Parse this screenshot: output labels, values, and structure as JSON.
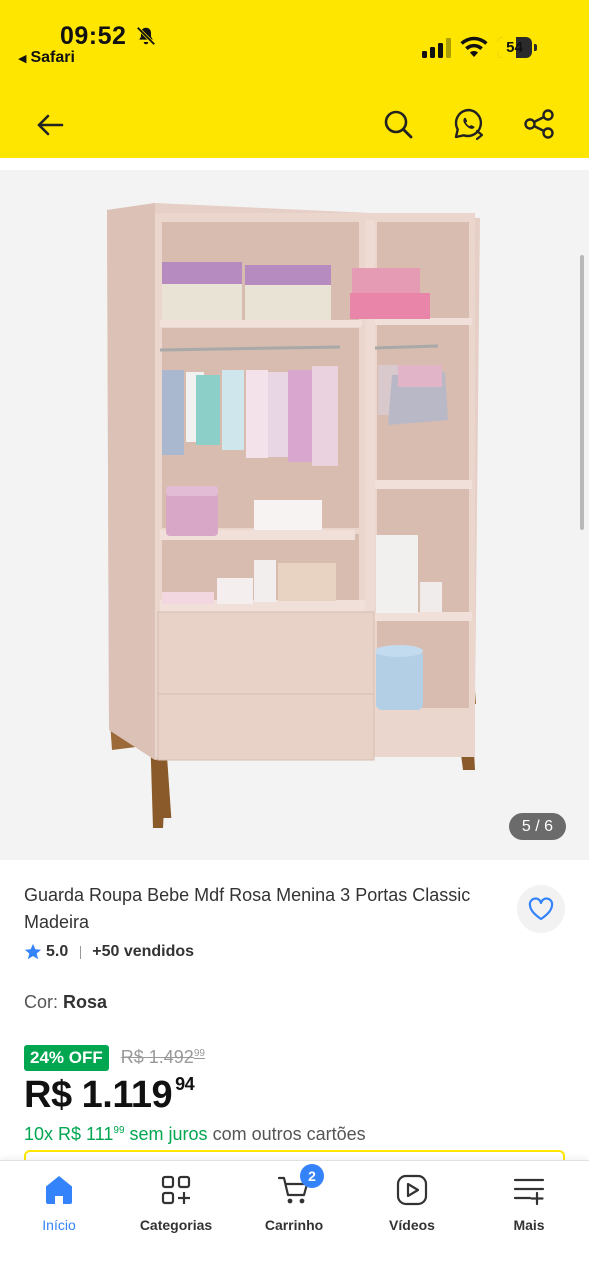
{
  "status_bar": {
    "time": "09:52",
    "back_app": "Safari",
    "battery_level": "54",
    "battery_fraction": 0.54
  },
  "header": {
    "bg_color": "#FFE600",
    "icons": [
      "back-arrow-icon",
      "search-icon",
      "whatsapp-share-icon",
      "share-icon"
    ]
  },
  "gallery": {
    "counter": "5 / 6"
  },
  "product": {
    "title": "Guarda Roupa Bebe Mdf Rosa Menina 3 Portas Classic Madeira",
    "rating": "5.0",
    "sold": "+50 vendidos",
    "color_label": "Cor:",
    "color_value": "Rosa",
    "discount": "24% OFF",
    "old_price_int": "R$ 1.492",
    "old_price_cents": "99",
    "price_int": "R$ 1.119",
    "price_cents": "94",
    "installments_prefix": "10x R$ 111",
    "installments_cents": "99",
    "installments_interest": " sem juros",
    "installments_rest": " com outros cartões",
    "accent_green": "#00A650"
  },
  "tabbar": {
    "accent": "#3483FA",
    "cart_count": "2",
    "items": [
      {
        "label": "Início",
        "icon": "home-icon",
        "active": true
      },
      {
        "label": "Categorias",
        "icon": "categories-icon",
        "active": false
      },
      {
        "label": "Carrinho",
        "icon": "cart-icon",
        "active": false
      },
      {
        "label": "Vídeos",
        "icon": "video-icon",
        "active": false
      },
      {
        "label": "Mais",
        "icon": "more-menu-icon",
        "active": false
      }
    ]
  }
}
